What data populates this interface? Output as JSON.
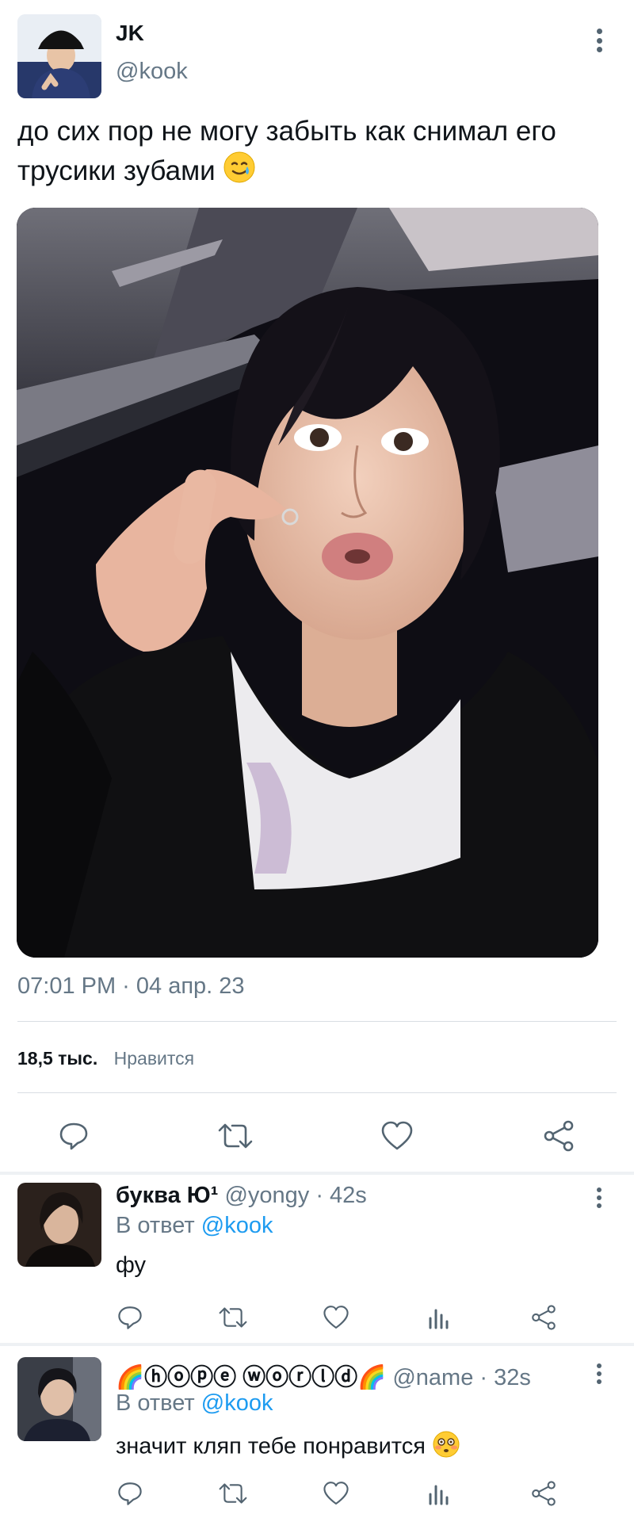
{
  "tweet": {
    "author_name": "JK",
    "author_handle": "@kook",
    "text": "до сих пор не могу забыть  как снимал его трусики зубами",
    "emoji": "smiling-tear",
    "timestamp": "07:01 PM · 04 апр. 23",
    "likes_count": "18,5 тыс.",
    "likes_label": "Нравится",
    "actions": [
      "reply-icon",
      "retweet-icon",
      "heart-icon",
      "share-icon"
    ]
  },
  "replies": [
    {
      "name": "буква Ю¹",
      "handle": "@yongy",
      "time": "· 42s",
      "reply_to_prefix": "В ответ",
      "reply_to_handle": "@kook",
      "text": "фу"
    },
    {
      "name": "🌈ⓗⓞⓟⓔ ⓦⓞⓡⓛⓓ🌈",
      "handle": "@name",
      "time": "· 32s",
      "reply_to_prefix": "В ответ",
      "reply_to_handle": "@kook",
      "text": "значит кляп тебе понравится",
      "emoji": "flushed-face"
    }
  ],
  "colors": {
    "link": "#1d9bf0",
    "muted": "#657786",
    "icon": "#536471",
    "divider": "#d9dee3"
  }
}
